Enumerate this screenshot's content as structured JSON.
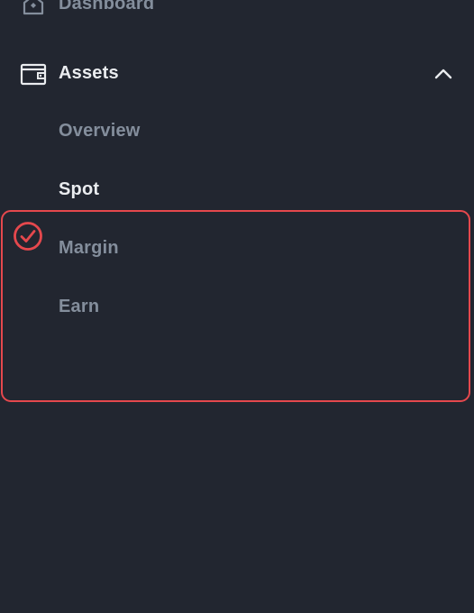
{
  "nav": {
    "dashboard": {
      "label": "Dashboard",
      "icon": "home-icon"
    },
    "assets": {
      "label": "Assets",
      "icon": "wallet-icon",
      "expanded_icon": "chevron-up-icon",
      "sub_items": [
        {
          "label": "Overview",
          "state": "inactive"
        },
        {
          "label": "Spot",
          "state": "active"
        },
        {
          "label": "Margin",
          "state": "inactive"
        },
        {
          "label": "Earn",
          "state": "inactive"
        }
      ]
    }
  },
  "annotation": {
    "icon": "check-circle-icon",
    "color": "#e5484d"
  },
  "colors": {
    "background": "#222630",
    "text_active": "#eaecef",
    "text_inactive": "#848e9c",
    "highlight": "#e5484d"
  }
}
